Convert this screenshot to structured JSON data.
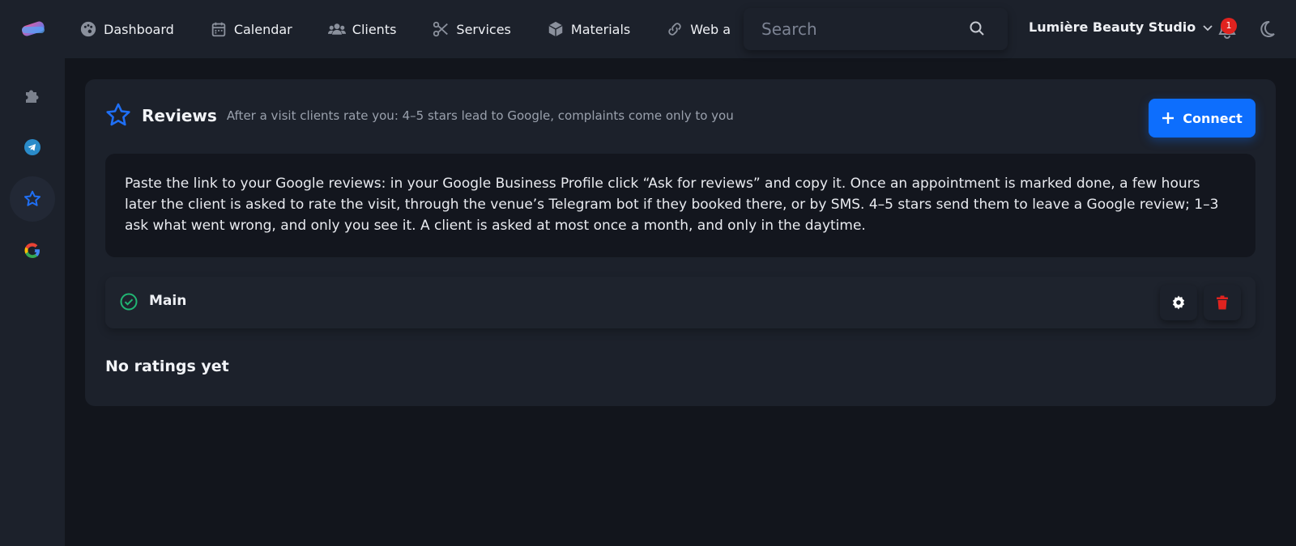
{
  "nav": {
    "items": [
      {
        "label": "Dashboard",
        "icon": "palette-icon"
      },
      {
        "label": "Calendar",
        "icon": "calendar-icon"
      },
      {
        "label": "Clients",
        "icon": "users-icon"
      },
      {
        "label": "Services",
        "icon": "scissors-icon"
      },
      {
        "label": "Materials",
        "icon": "box-icon"
      },
      {
        "label": "Web a",
        "icon": "link-icon"
      }
    ]
  },
  "search": {
    "placeholder": "Search"
  },
  "studio": {
    "name": "Lumière Beauty Studio"
  },
  "notifications": {
    "count": "1"
  },
  "sidebar": {
    "items": [
      {
        "icon": "puzzle-icon",
        "active": false
      },
      {
        "icon": "telegram-icon",
        "active": false
      },
      {
        "icon": "star-icon",
        "active": true
      },
      {
        "icon": "google-icon",
        "active": false
      }
    ]
  },
  "reviews": {
    "title": "Reviews",
    "subtitle": "After a visit clients rate you: 4–5 stars lead to Google, complaints come only to you",
    "connect_label": "Connect",
    "info": "Paste the link to your Google reviews: in your Google Business Profile click “Ask for reviews” and copy it. Once an appointment is marked done, a few hours later the client is asked to rate the visit, through the venue’s Telegram bot if they booked there, or by SMS. 4–5 stars send them to leave a Google review; 1–3 ask what went wrong, and only you see it. A client is asked at most once a month, and only in the daytime.",
    "connection": {
      "name": "Main",
      "status": "active"
    },
    "empty_text": "No ratings yet"
  },
  "colors": {
    "accent": "#0d6efd",
    "success": "#21b573",
    "danger": "#e0231f"
  }
}
